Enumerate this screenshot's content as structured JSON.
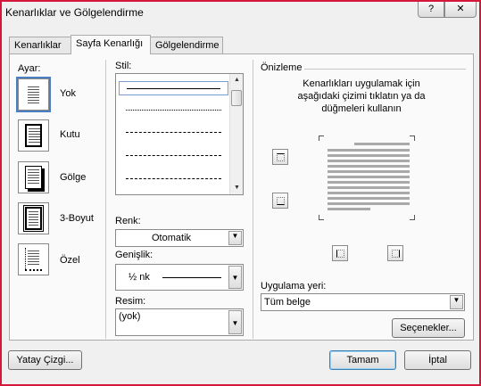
{
  "window": {
    "title": "Kenarlıklar ve Gölgelendirme",
    "help_label": "?",
    "close_label": "✕"
  },
  "tabs": [
    {
      "label": "Kenarlıklar",
      "active": false
    },
    {
      "label": "Sayfa Kenarlığı",
      "active": true
    },
    {
      "label": "Gölgelendirme",
      "active": false
    }
  ],
  "setting": {
    "label": "Ayar:",
    "items": [
      {
        "label": "Yok",
        "selected": true
      },
      {
        "label": "Kutu",
        "selected": false
      },
      {
        "label": "Gölge",
        "selected": false
      },
      {
        "label": "3-Boyut",
        "selected": false
      },
      {
        "label": "Özel",
        "selected": false
      }
    ]
  },
  "style": {
    "label": "Stil:",
    "options": [
      "solid",
      "dotted",
      "dashed",
      "dashed-wide",
      "dash-dot"
    ],
    "selected": "solid"
  },
  "color": {
    "label": "Renk:",
    "value": "Otomatik"
  },
  "width": {
    "label": "Genişlik:",
    "value": "½ nk"
  },
  "art": {
    "label": "Resim:",
    "value": "(yok)"
  },
  "preview": {
    "label": "Önizleme",
    "hint_line1": "Kenarlıkları uygulamak için",
    "hint_line2": "aşağıdaki çizimi tıklatın ya da",
    "hint_line3": "düğmeleri kullanın"
  },
  "apply_to": {
    "label": "Uygulama yeri:",
    "value": "Tüm belge"
  },
  "buttons": {
    "options": "Seçenekler...",
    "horizontal_line": "Yatay Çizgi...",
    "ok": "Tamam",
    "cancel": "İptal"
  },
  "colors": {
    "accent": "#4a7fc1",
    "window_border": "#d4173a",
    "preview_lines": "#a9a9a9"
  }
}
